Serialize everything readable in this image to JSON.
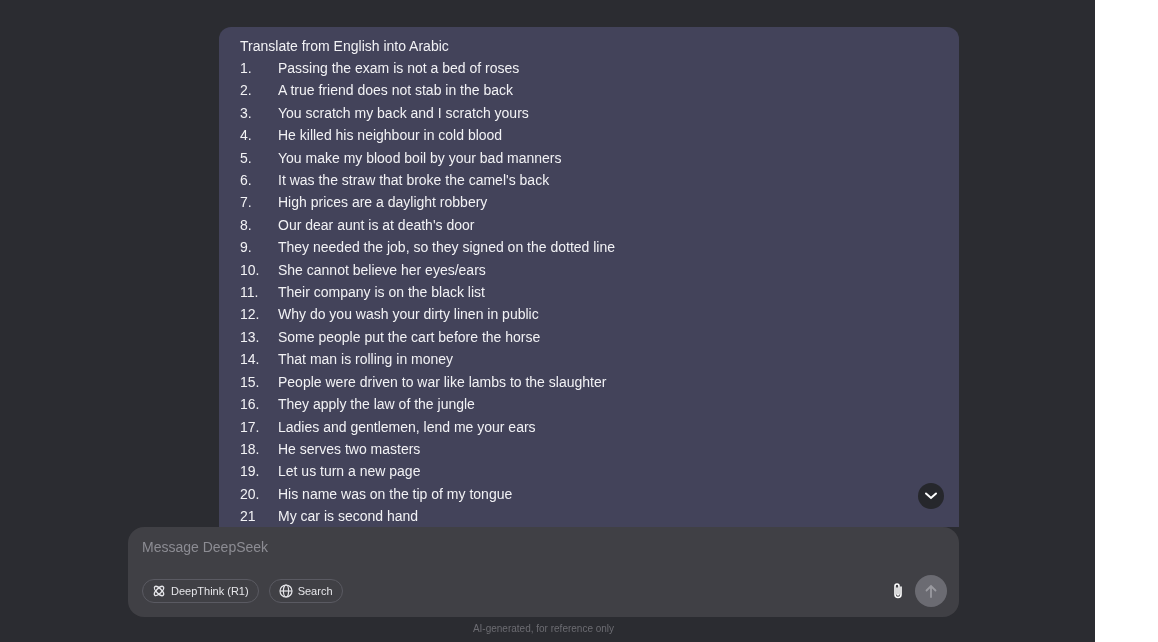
{
  "message": {
    "heading": "Translate from English into Arabic",
    "items": [
      {
        "number": "1.",
        "text": "Passing the exam is not a bed of roses"
      },
      {
        "number": "2.",
        "text": "A true friend does not stab in the back"
      },
      {
        "number": "3.",
        "text": "You scratch my back and I scratch yours"
      },
      {
        "number": "4.",
        "text": "He killed his neighbour in cold blood"
      },
      {
        "number": "5.",
        "text": "You make my blood boil by your bad manners"
      },
      {
        "number": "6.",
        "text": "It was the straw that broke the camel's back"
      },
      {
        "number": "7.",
        "text": "High prices are a daylight robbery"
      },
      {
        "number": "8.",
        "text": "Our dear aunt is at death's door"
      },
      {
        "number": "9.",
        "text": "They needed the job, so they signed on the dotted line"
      },
      {
        "number": "10.",
        "text": "She cannot believe her eyes/ears"
      },
      {
        "number": "11.",
        "text": "Their company is on the black list"
      },
      {
        "number": "12.",
        "text": "Why do you wash your dirty linen in public"
      },
      {
        "number": "13.",
        "text": "Some people put the cart before the horse"
      },
      {
        "number": "14.",
        "text": "That man is rolling in money"
      },
      {
        "number": "15.",
        "text": "People were driven to war like lambs to the slaughter"
      },
      {
        "number": "16.",
        "text": "They apply the law of the jungle"
      },
      {
        "number": "17.",
        "text": "Ladies and gentlemen, lend me your ears"
      },
      {
        "number": "18.",
        "text": "He serves two masters"
      },
      {
        "number": "19.",
        "text": "Let us turn a new page"
      },
      {
        "number": "20.",
        "text": "His name was on the tip of my tongue"
      },
      {
        "number": "21",
        "text": "My car is second hand"
      }
    ]
  },
  "composer": {
    "placeholder": "Message DeepSeek",
    "toggles": [
      {
        "label": "DeepThink (R1)",
        "kind": "atom",
        "selected": false
      },
      {
        "label": "Search",
        "kind": "globe",
        "selected": false
      }
    ],
    "send_disabled": true
  },
  "footer": "AI-generated, for reference only"
}
